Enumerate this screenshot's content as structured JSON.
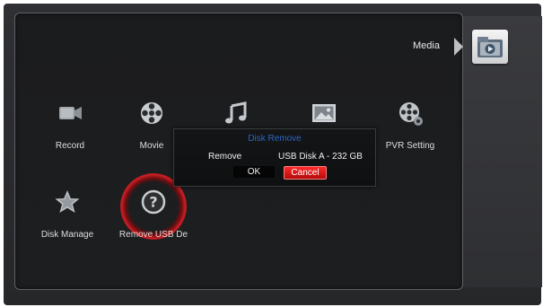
{
  "header": {
    "section_label": "Media",
    "section_icon": "media-folder-icon"
  },
  "menu": {
    "items": [
      {
        "label": "Record",
        "icon": "record-camera-icon"
      },
      {
        "label": "Movie",
        "icon": "film-reel-icon"
      },
      {
        "label": "",
        "icon": "music-note-icon"
      },
      {
        "label": "",
        "icon": "photo-icon"
      },
      {
        "label": "PVR Setting",
        "icon": "pvr-setting-icon"
      },
      {
        "label": "Disk Manage",
        "icon": "star-icon"
      },
      {
        "label": "Remove USB De",
        "icon": "question-icon"
      }
    ],
    "selected_item": "Remove USB De"
  },
  "dialog": {
    "title": "Disk Remove",
    "field_label": "Remove",
    "field_value": "USB Disk A - 232 GB",
    "ok_label": "OK",
    "cancel_label": "Cancel",
    "focused_button": "Cancel"
  },
  "colors": {
    "dialog_title": "#2a67c6",
    "focus_red": "#c81f24",
    "panel_background": "#1c1d1f"
  }
}
